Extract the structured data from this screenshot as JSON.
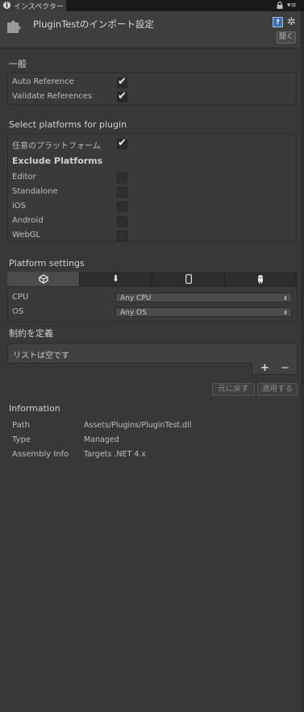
{
  "tab": {
    "label": "インスペクター"
  },
  "header": {
    "title": "PluginTestのインポート設定",
    "open_label": "開く"
  },
  "general": {
    "heading": "一般",
    "auto_reference_label": "Auto Reference",
    "auto_reference": true,
    "validate_references_label": "Validate References",
    "validate_references": true
  },
  "platforms": {
    "heading": "Select platforms for plugin",
    "any_platform_label": "任意のプラットフォーム",
    "any_platform": true,
    "exclude_heading": "Exclude Platforms",
    "exclude": [
      {
        "label": "Editor",
        "checked": false
      },
      {
        "label": "Standalone",
        "checked": false
      },
      {
        "label": "iOS",
        "checked": false
      },
      {
        "label": "Android",
        "checked": false
      },
      {
        "label": "WebGL",
        "checked": false
      }
    ]
  },
  "platform_settings": {
    "heading": "Platform settings",
    "tabs": [
      {
        "icon": "unity-icon",
        "active": true
      },
      {
        "icon": "download-icon",
        "active": false
      },
      {
        "icon": "mobile-icon",
        "active": false
      },
      {
        "icon": "android-icon",
        "active": false
      }
    ],
    "cpu_label": "CPU",
    "cpu_value": "Any CPU",
    "os_label": "OS",
    "os_value": "Any OS"
  },
  "constraints": {
    "heading": "制約を定義",
    "empty_text": "リストは空です",
    "add_label": "+",
    "remove_label": "−"
  },
  "actions": {
    "revert_label": "元に戻す",
    "apply_label": "適用する"
  },
  "information": {
    "heading": "Information",
    "rows": [
      {
        "key": "Path",
        "value": "Assets/Plugins/PluginTest.dll"
      },
      {
        "key": "Type",
        "value": "Managed"
      },
      {
        "key": "Assembly Info",
        "value": "Targets .NET 4.x"
      }
    ]
  },
  "colors": {
    "background": "#383838",
    "active_tab": "#4b4b4b",
    "help_blue": "#3d6fb3"
  }
}
